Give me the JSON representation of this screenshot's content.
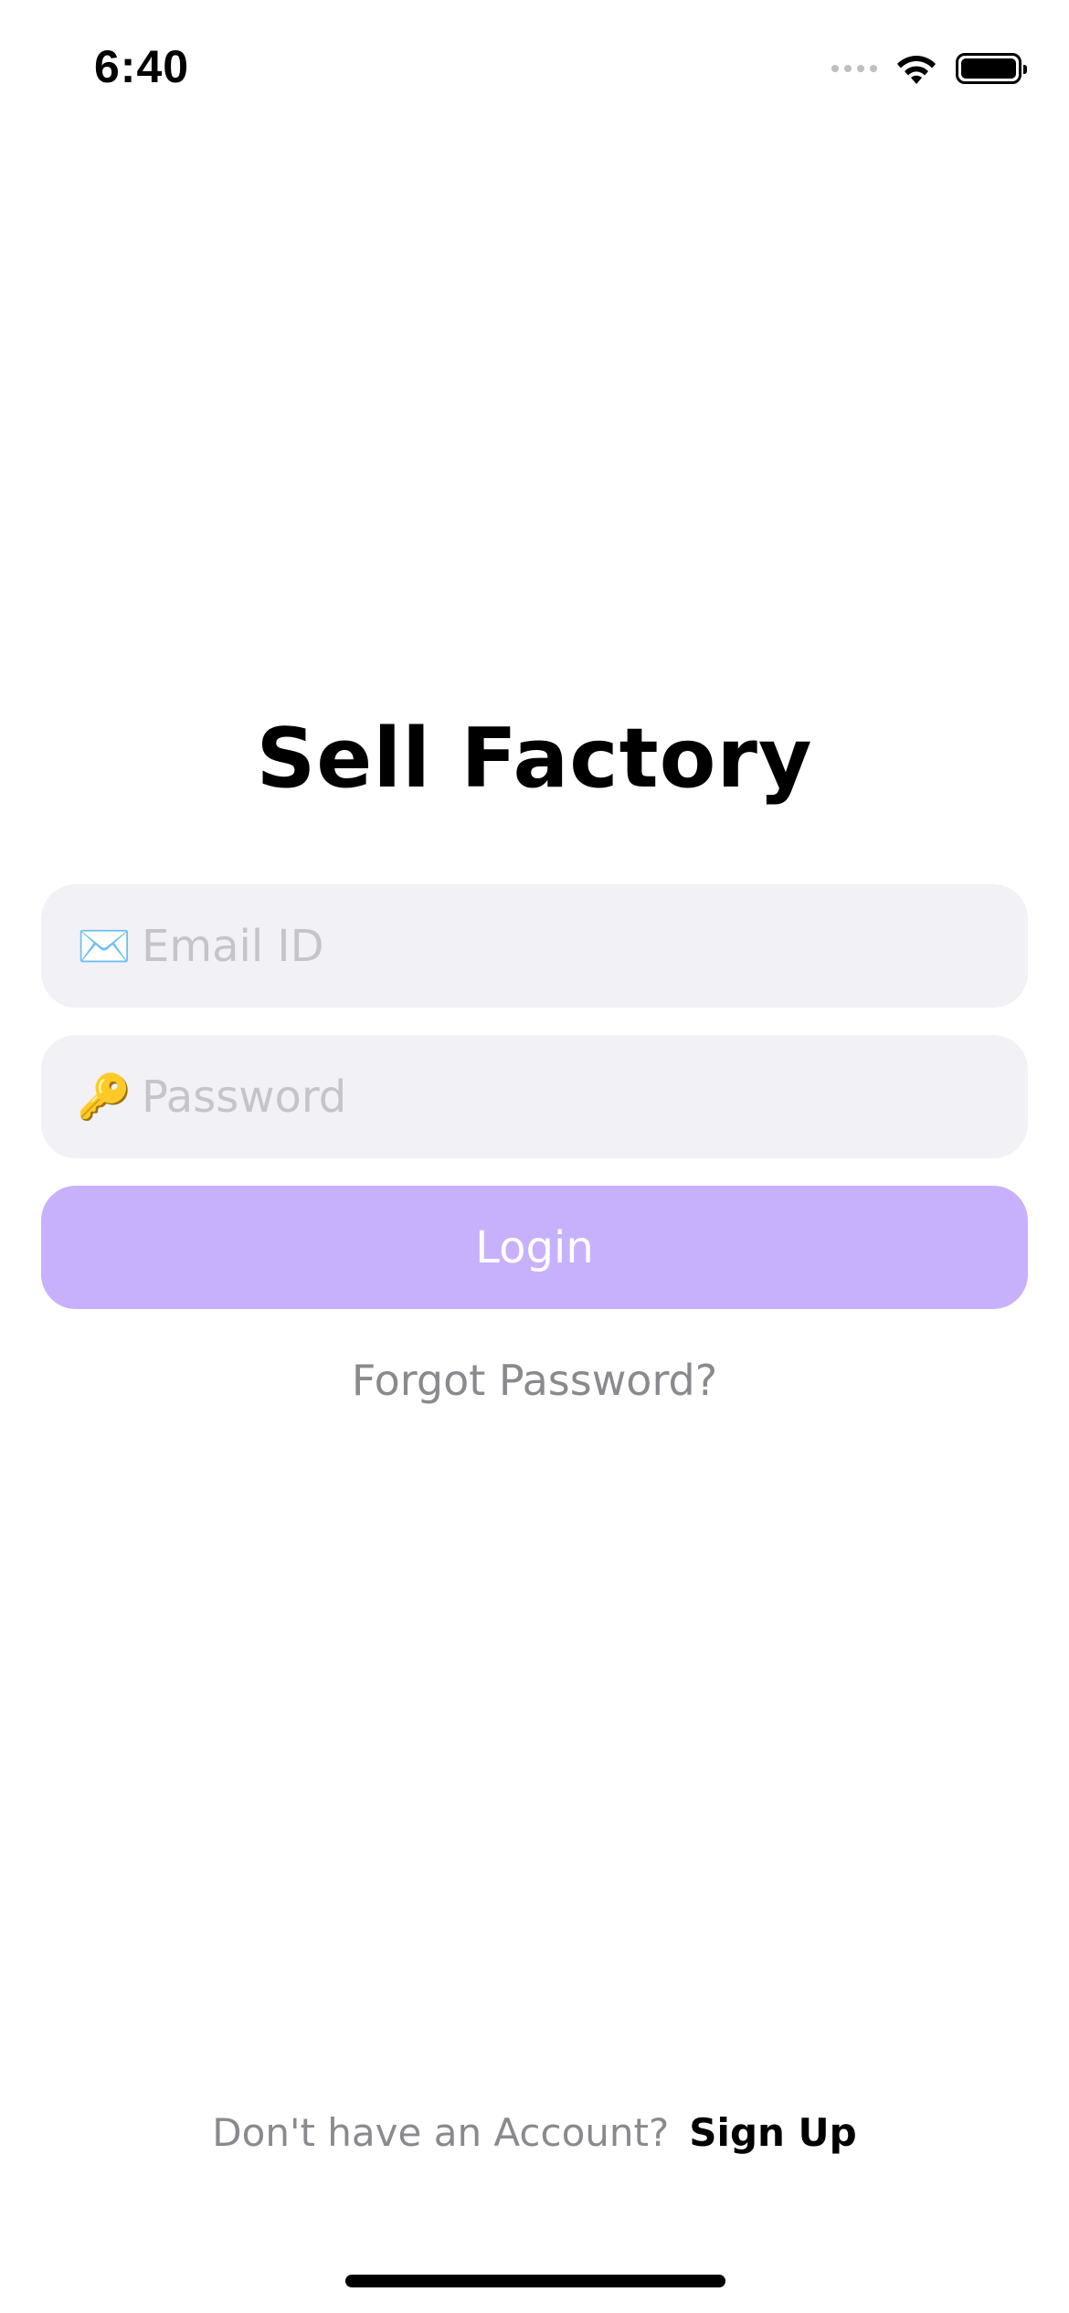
{
  "status_bar": {
    "time": "6:40",
    "icons": [
      "cellular-signal-icon",
      "wifi-icon",
      "battery-icon"
    ]
  },
  "app": {
    "title": "Sell Factory"
  },
  "form": {
    "email": {
      "icon": "envelope-icon",
      "glyph": "✉️",
      "placeholder": "Email ID",
      "value": ""
    },
    "password": {
      "icon": "key-icon",
      "glyph": "🔑",
      "placeholder": "Password",
      "value": ""
    },
    "login_label": "Login",
    "forgot_label": "Forgot Password?"
  },
  "footer": {
    "prompt": "Don't have an Account?",
    "signup_label": "Sign Up"
  },
  "colors": {
    "field_bg": "#f1f1f6",
    "button_bg": "#c7b1fc",
    "muted_text": "#8a8a8e"
  }
}
